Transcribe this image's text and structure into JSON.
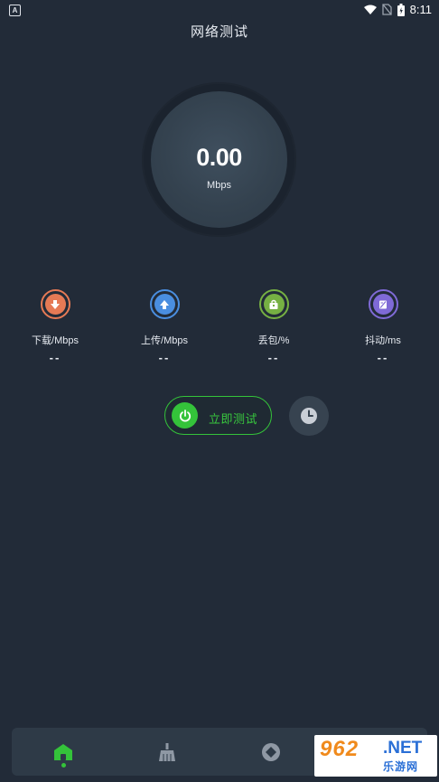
{
  "status_bar": {
    "time": "8:11",
    "left_icon": "A"
  },
  "header": {
    "title": "网络测试"
  },
  "gauge": {
    "speed": "0.00",
    "unit": "Mbps"
  },
  "metrics": [
    {
      "label": "下载/Mbps",
      "value": "--",
      "icon": "download-icon",
      "color": "#e67a55"
    },
    {
      "label": "上传/Mbps",
      "value": "--",
      "icon": "upload-icon",
      "color": "#4a8ee0"
    },
    {
      "label": "丢包/%",
      "value": "--",
      "icon": "packet-loss-icon",
      "color": "#76b043"
    },
    {
      "label": "抖动/ms",
      "value": "--",
      "icon": "jitter-icon",
      "color": "#7f6ad6"
    }
  ],
  "actions": {
    "start_label": "立即测试",
    "history_icon": "clock-icon"
  },
  "bottom_nav": {
    "items": [
      {
        "icon": "home-icon",
        "active": true
      },
      {
        "icon": "broom-icon",
        "active": false
      },
      {
        "icon": "diamond-icon",
        "active": false
      }
    ]
  },
  "watermark": {
    "number": "962",
    "net": ".NET",
    "cn": "乐游网"
  },
  "colors": {
    "background": "#222b38",
    "accent": "#34c33a",
    "nav": "#2e3a47"
  }
}
